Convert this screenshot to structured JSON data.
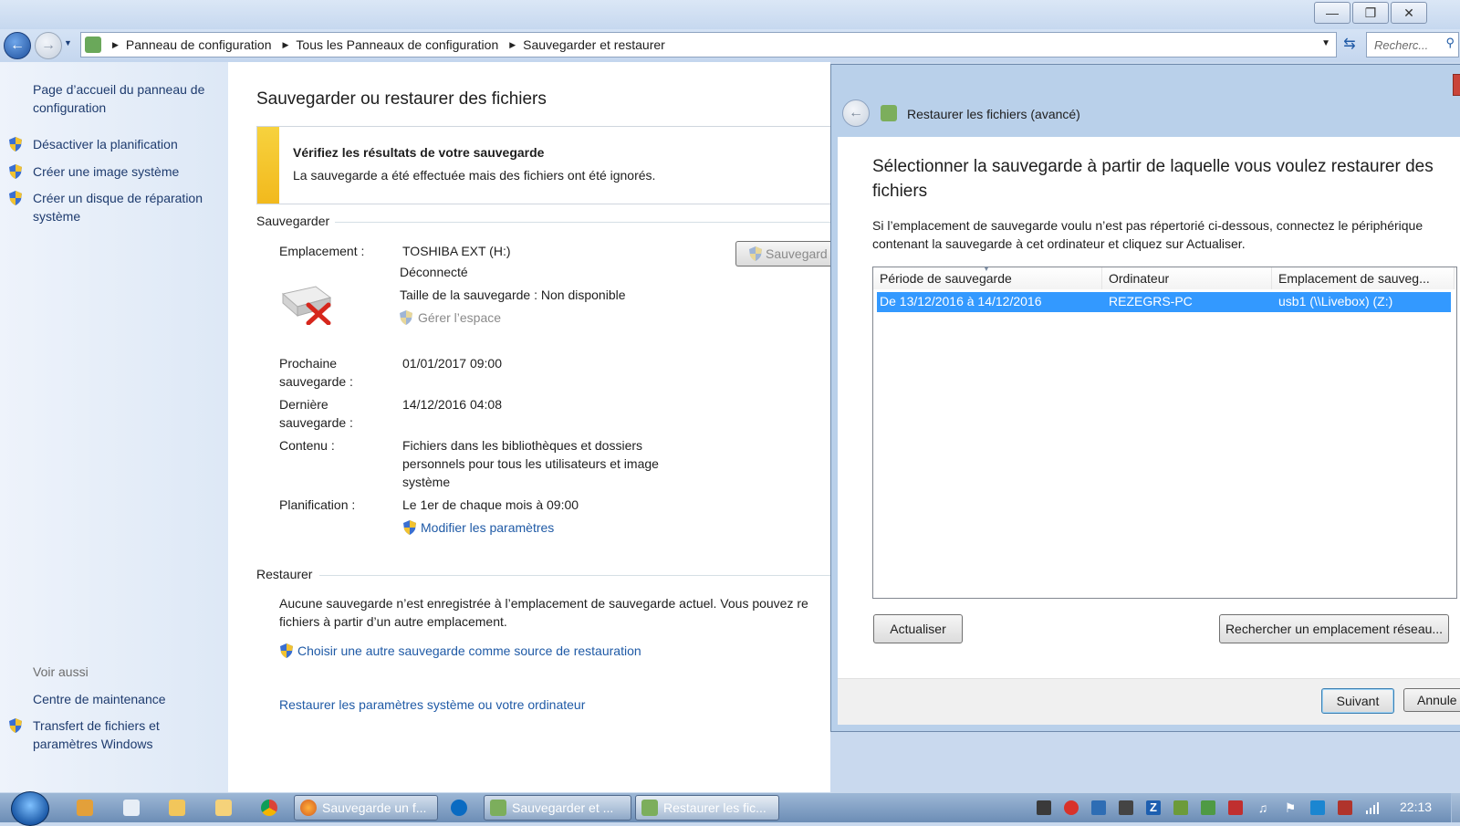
{
  "explorer": {
    "breadcrumb": [
      "Panneau de configuration",
      "Tous les Panneaux de configuration",
      "Sauvegarder et restaurer"
    ],
    "search_placeholder": "Recherc..."
  },
  "left_pane": {
    "home_link": "Page d’accueil du panneau de configuration",
    "tasks": [
      "Désactiver la planification",
      "Créer une image système",
      "Créer un disque de réparation système"
    ],
    "see_also_title": "Voir aussi",
    "see_also": [
      "Centre de maintenance",
      "Transfert de fichiers et paramètres Windows"
    ]
  },
  "main": {
    "title": "Sauvegarder ou restaurer des fichiers",
    "warning": {
      "heading": "Vérifiez les résultats de votre sauvegarde",
      "text": "La sauvegarde a été effectuée mais des fichiers ont été ignorés."
    },
    "backup_section": "Sauvegarder",
    "backup_button": "Sauvegard",
    "location_label": "Emplacement :",
    "location_value": "TOSHIBA EXT (H:)",
    "status": "Déconnecté",
    "size": "Taille de la sauvegarde : Non disponible",
    "manage_space": "Gérer l’espace",
    "next_label": "Prochaine sauvegarde :",
    "next_value": "01/01/2017 09:00",
    "last_label": "Dernière sauvegarde :",
    "last_value": "14/12/2016 04:08",
    "content_label": "Contenu :",
    "content_value": "Fichiers dans les bibliothèques et dossiers personnels pour tous les utilisateurs et image système",
    "schedule_label": "Planification :",
    "schedule_value": "Le 1er de chaque mois à 09:00",
    "modify_link": "Modifier les paramètres",
    "restore_section": "Restaurer",
    "restore_text": "Aucune sauvegarde n’est enregistrée à l’emplacement de sauvegarde actuel. Vous pouvez re fichiers à partir d’un autre emplacement.",
    "choose_link": "Choisir une autre sauvegarde comme source de restauration",
    "restore_system_link": "Restaurer les paramètres système ou votre ordinateur"
  },
  "dialog": {
    "title": "Restaurer les fichiers (avancé)",
    "heading": "Sélectionner la sauvegarde à partir de laquelle vous voulez restaurer des fichiers",
    "description": "Si l’emplacement de sauvegarde voulu n’est pas répertorié ci-dessous, connectez le périphérique contenant la sauvegarde à cet ordinateur et cliquez sur Actualiser.",
    "columns": [
      "Période de sauvegarde",
      "Ordinateur",
      "Emplacement de sauveg..."
    ],
    "rows": [
      {
        "period": "De 13/12/2016 à 14/12/2016",
        "computer": "REZEGRS-PC",
        "location": "usb1 (\\\\Livebox) (Z:)"
      }
    ],
    "refresh_button": "Actualiser",
    "browse_network_button": "Rechercher un emplacement réseau...",
    "next_button": "Suivant",
    "cancel_button": "Annule"
  },
  "taskbar": {
    "tasks": [
      "Sauvegarde un f...",
      "Sauvegarder et ...",
      "Restaurer les fic..."
    ],
    "clock": "22:13"
  }
}
